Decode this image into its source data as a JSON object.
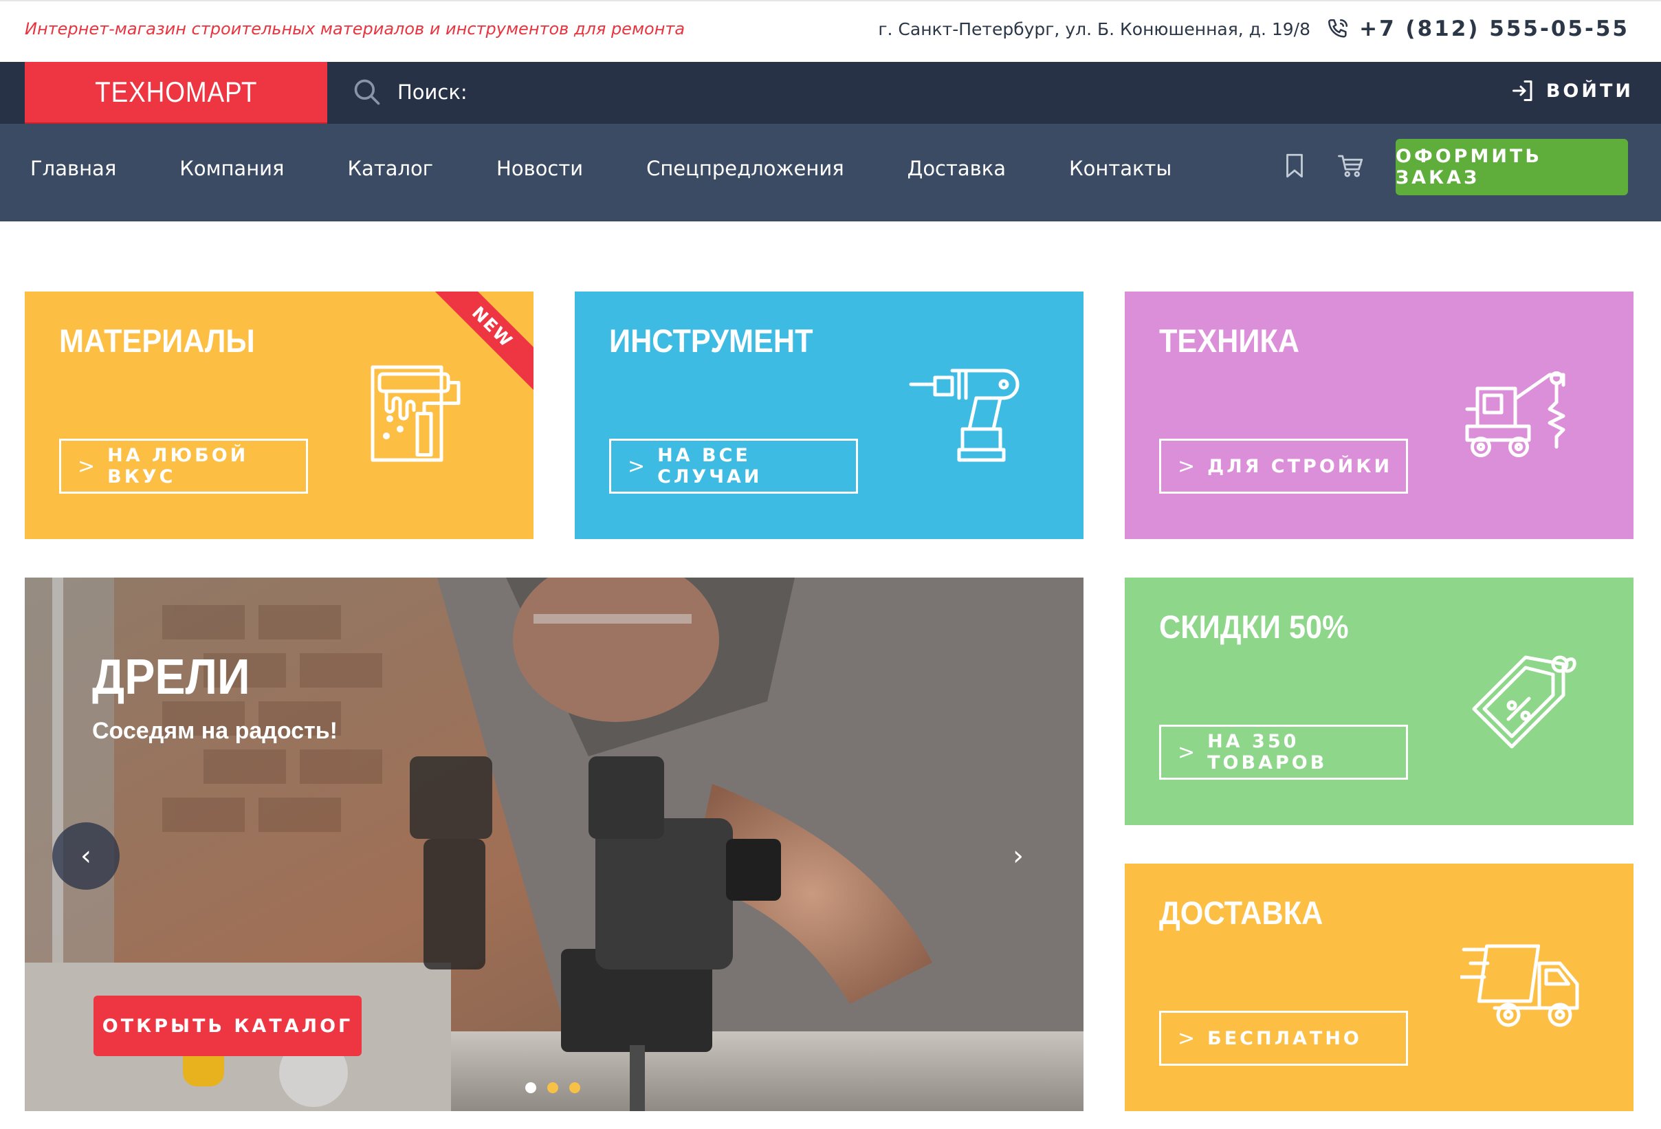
{
  "header": {
    "tagline": "Интернет-магазин строительных материалов и инструментов для ремонта",
    "address": "г. Санкт-Петербург, ул. Б. Конюшенная, д. 19/8",
    "phone": "+7 (812) 555-05-55",
    "phone_icon": "phone-icon"
  },
  "topnav": {
    "logo_text": "ТЕХНОМАРТ",
    "search_placeholder": "Поиск:",
    "search_icon": "search-icon",
    "login_label": "ВОЙТИ",
    "login_icon": "login-icon"
  },
  "mainnav": {
    "items": [
      "Главная",
      "Компания",
      "Каталог",
      "Новости",
      "Спецпредложения",
      "Доставка",
      "Контакты"
    ],
    "bookmark_icon": "bookmark-icon",
    "cart_icon": "cart-icon",
    "order_label": "ОФОРМИТЬ ЗАКАЗ"
  },
  "cards": {
    "materials": {
      "title": "МАТЕРИАЛЫ",
      "cta": "НА ЛЮБОЙ ВКУС",
      "badge": "NEW",
      "color": "#fdbe44",
      "icon": "paint-roller-icon"
    },
    "tools": {
      "title": "ИНСТРУМЕНТ",
      "cta": "НА ВСЕ СЛУЧАИ",
      "color": "#3dbbe3",
      "icon": "drill-icon"
    },
    "machinery": {
      "title": "ТЕХНИКА",
      "cta": "ДЛЯ СТРОЙКИ",
      "color": "#dc8fd9",
      "icon": "excavator-icon"
    },
    "discounts": {
      "title": "СКИДКИ 50%",
      "cta": "НА 350 ТОВАРОВ",
      "color": "#8dd68a",
      "icon": "price-tag-icon"
    },
    "delivery": {
      "title": "ДОСТАВКА",
      "cta": "БЕСПЛАТНО",
      "color": "#fdbe44",
      "icon": "delivery-truck-icon"
    }
  },
  "slider": {
    "title": "ДРЕЛИ",
    "subtitle": "Соседям на радость!",
    "button": "ОТКРЫТЬ КАТАЛОГ",
    "prev_icon": "chevron-left-icon",
    "next_icon": "chevron-right-icon",
    "slide_count": 3,
    "active_slide": 1,
    "prev_glyph": "‹",
    "next_glyph": "›"
  },
  "colors": {
    "accent_red": "#ee3643",
    "dark_navy": "#283247",
    "nav_blue": "#3b4b64",
    "order_green": "#5fad3b"
  }
}
